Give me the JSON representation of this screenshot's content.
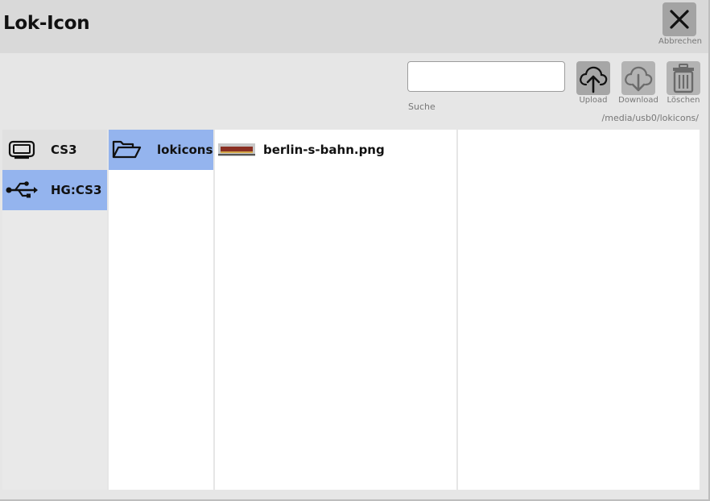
{
  "window": {
    "title": "Lok-Icon",
    "close_label": "Abbrechen"
  },
  "toolbar": {
    "search_value": "",
    "search_label": "Suche",
    "upload_label": "Upload",
    "download_label": "Download",
    "delete_label": "Löschen",
    "current_path": "/media/usb0/lokicons/"
  },
  "devices": [
    {
      "label": "CS3",
      "icon": "monitor-icon",
      "selected": false
    },
    {
      "label": "HG:CS3",
      "icon": "usb-icon",
      "selected": true
    }
  ],
  "folders": [
    {
      "label": "lokicons",
      "icon": "folder-open-icon",
      "selected": true
    }
  ],
  "files": [
    {
      "label": "berlin-s-bahn.png",
      "icon": "train-thumbnail"
    }
  ],
  "colors": {
    "selection": "#94b4ee",
    "button": "#a6a6a6"
  }
}
